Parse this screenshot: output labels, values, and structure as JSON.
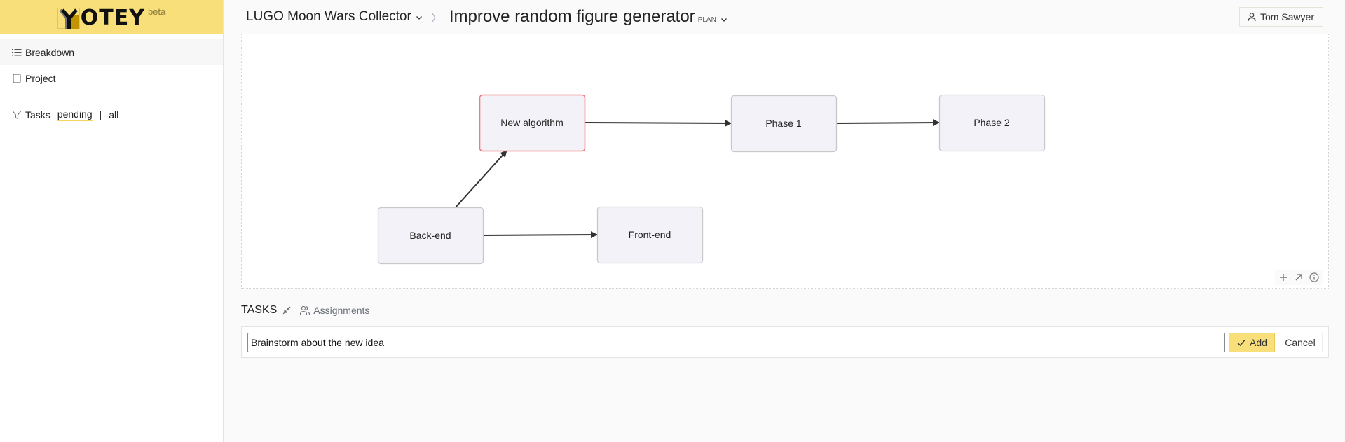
{
  "app": {
    "logo_text": "OTEY",
    "logo_badge": "beta",
    "brand_color": "#f8df7a"
  },
  "sidebar": {
    "items": [
      {
        "label": "Breakdown",
        "icon": "list-icon",
        "active": true
      },
      {
        "label": "Project",
        "icon": "book-icon",
        "active": false
      }
    ],
    "filter": {
      "label": "Tasks",
      "icon": "filter-icon",
      "options": [
        "pending",
        "all"
      ],
      "selected": "pending",
      "separator": "|"
    }
  },
  "header": {
    "project": "LUGO Moon Wars Collector",
    "separator": "〉",
    "title": "Improve random figure generator",
    "badge": "PLAN",
    "user": "Tom Sawyer"
  },
  "diagram": {
    "nodes": [
      {
        "id": "new-algorithm",
        "label": "New algorithm",
        "highlighted": true
      },
      {
        "id": "phase-1",
        "label": "Phase 1",
        "highlighted": false
      },
      {
        "id": "phase-2",
        "label": "Phase 2",
        "highlighted": false
      },
      {
        "id": "back-end",
        "label": "Back-end",
        "highlighted": false
      },
      {
        "id": "front-end",
        "label": "Front-end",
        "highlighted": false
      }
    ],
    "edges": [
      {
        "from": "new-algorithm",
        "to": "phase-1"
      },
      {
        "from": "phase-1",
        "to": "phase-2"
      },
      {
        "from": "back-end",
        "to": "new-algorithm"
      },
      {
        "from": "back-end",
        "to": "front-end"
      }
    ],
    "tools": [
      "plus-icon",
      "expand-icon",
      "info-icon"
    ],
    "highlight_color": "#f07c7c",
    "node_fill": "#f3f2f8",
    "node_stroke": "#c8c8c8"
  },
  "tasks": {
    "title": "TASKS",
    "assignments_label": "Assignments",
    "input_value": "Brainstorm about the new idea",
    "add_label": "Add",
    "cancel_label": "Cancel"
  }
}
